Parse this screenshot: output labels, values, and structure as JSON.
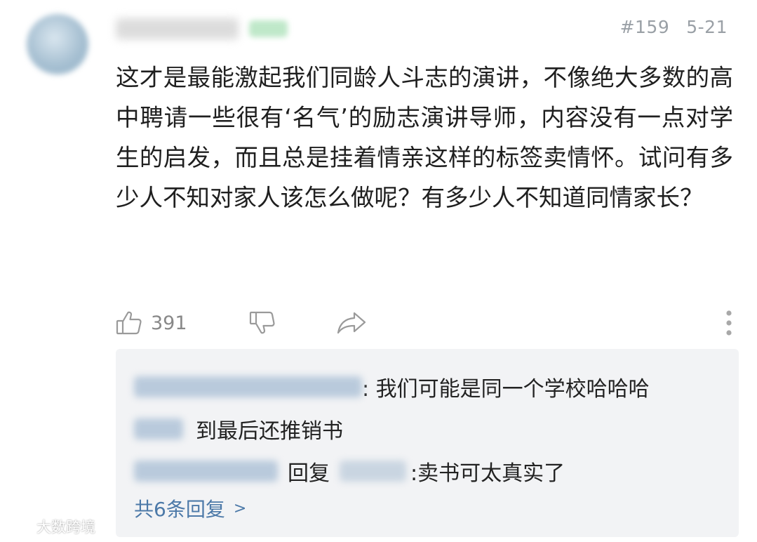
{
  "comment": {
    "floor": "#159",
    "date": "5-21",
    "text": "这才是最能激起我们同龄人斗志的演讲，不像绝大多数的高中聘请一些很有‘名气’的励志演讲导师，内容没有一点对学生的启发，而且总是挂着情亲这样的标签卖情怀。试问有多少人不知对家人该怎么做呢？有多少人不知道同情家长？",
    "like_count": "391"
  },
  "actions": {
    "like_icon": "thumbs-up-icon",
    "dislike_icon": "thumbs-down-icon",
    "share_icon": "share-icon",
    "more_icon": "more-vertical-icon"
  },
  "replies": {
    "items": [
      {
        "text": ": 我们可能是同一个学校哈哈哈"
      },
      {
        "text": "到最后还推销书"
      },
      {
        "reply_word": "回复",
        "text": ":卖书可太真实了"
      }
    ],
    "view_all": "共6条回复",
    "view_all_chevron": ">"
  },
  "watermark": {
    "text": "大数跨境"
  },
  "colors": {
    "link": "#4c79a8",
    "meta": "#9aa0a6",
    "reply_bg": "#f2f3f5"
  }
}
